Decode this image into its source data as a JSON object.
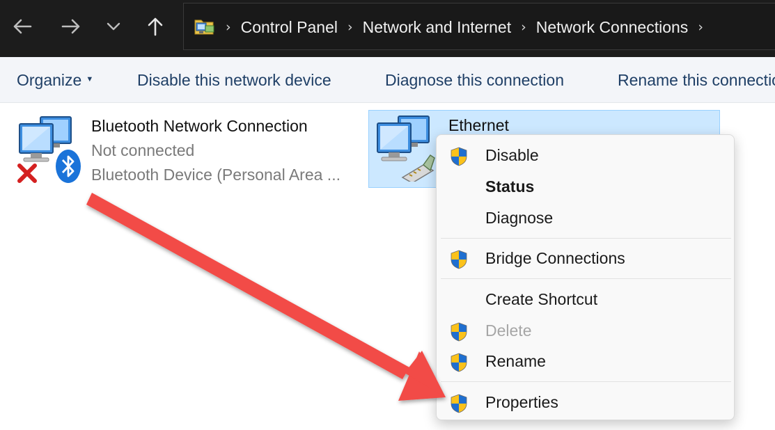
{
  "address_bar": {
    "crumbs": [
      "Control Panel",
      "Network and Internet",
      "Network Connections"
    ],
    "separator": "›",
    "nav_icons": [
      "back-arrow-icon",
      "forward-arrow-icon",
      "chevron-down-icon",
      "up-arrow-icon"
    ],
    "location_icon": "control-panel-folder-icon"
  },
  "command_bar": {
    "organize": "Organize",
    "disable": "Disable this network device",
    "diagnose": "Diagnose this connection",
    "rename": "Rename this connection"
  },
  "connections": [
    {
      "name": "Bluetooth Network Connection",
      "status": "Not connected",
      "device": "Bluetooth Device (Personal Area ...",
      "icon": "network-computers-icon",
      "badges": [
        "red-x-icon",
        "bluetooth-icon"
      ]
    },
    {
      "name": "Ethernet",
      "selected": true,
      "icon": "network-computers-icon",
      "badges": [
        "ethernet-plug-icon"
      ]
    }
  ],
  "context_menu": {
    "items": [
      {
        "label": "Disable",
        "shield": true
      },
      {
        "label": "Status",
        "bold": true
      },
      {
        "label": "Diagnose"
      },
      {
        "label": "Bridge Connections",
        "shield": true
      },
      {
        "label": "Create Shortcut"
      },
      {
        "label": "Delete",
        "shield": true,
        "disabled": true
      },
      {
        "label": "Rename",
        "shield": true
      },
      {
        "label": "Properties",
        "shield": true
      }
    ]
  },
  "colors": {
    "address_bar_bg": "#1c1c1c",
    "command_bar_bg": "#f3f5f9",
    "command_text": "#1f3f66",
    "selection_bg": "#cce8ff",
    "selection_border": "#99d1ff",
    "annotation_arrow": "#f24b46"
  },
  "annotation": {
    "icon": "red-arrow-icon"
  }
}
